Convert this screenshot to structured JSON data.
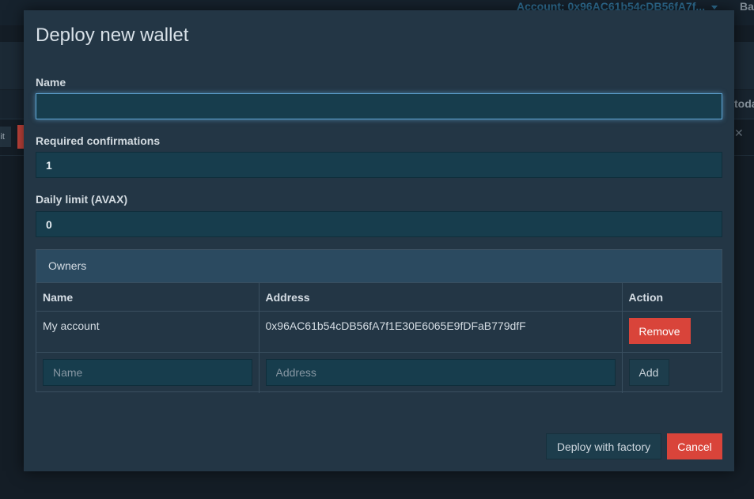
{
  "background": {
    "account_label": "Account: 0x96AC61b54cDB56fA7f...",
    "cutoff_right_top": "Ba",
    "cutoff_right_row": "toda",
    "cutoff_left_button": "lit"
  },
  "modal": {
    "title": "Deploy new wallet",
    "name_field": {
      "label": "Name",
      "value": ""
    },
    "confirmations_field": {
      "label": "Required confirmations",
      "value": "1"
    },
    "daily_limit_field": {
      "label": "Daily limit (AVAX)",
      "value": "0"
    },
    "owners": {
      "heading": "Owners",
      "columns": [
        "Name",
        "Address",
        "Action"
      ],
      "rows": [
        {
          "name": "My account",
          "address": "0x96AC61b54cDB56fA7f1E30E6065E9fDFaB779dfF",
          "action": "Remove"
        }
      ],
      "new_owner": {
        "name_placeholder": "Name",
        "address_placeholder": "Address",
        "add_label": "Add"
      }
    },
    "footer": {
      "deploy_label": "Deploy with factory",
      "cancel_label": "Cancel"
    }
  },
  "colors": {
    "modal_bg": "#233645",
    "input_bg": "#173d4d",
    "danger": "#d9443a",
    "focus": "#5fa6d6",
    "panel_head": "#2b4a60"
  }
}
